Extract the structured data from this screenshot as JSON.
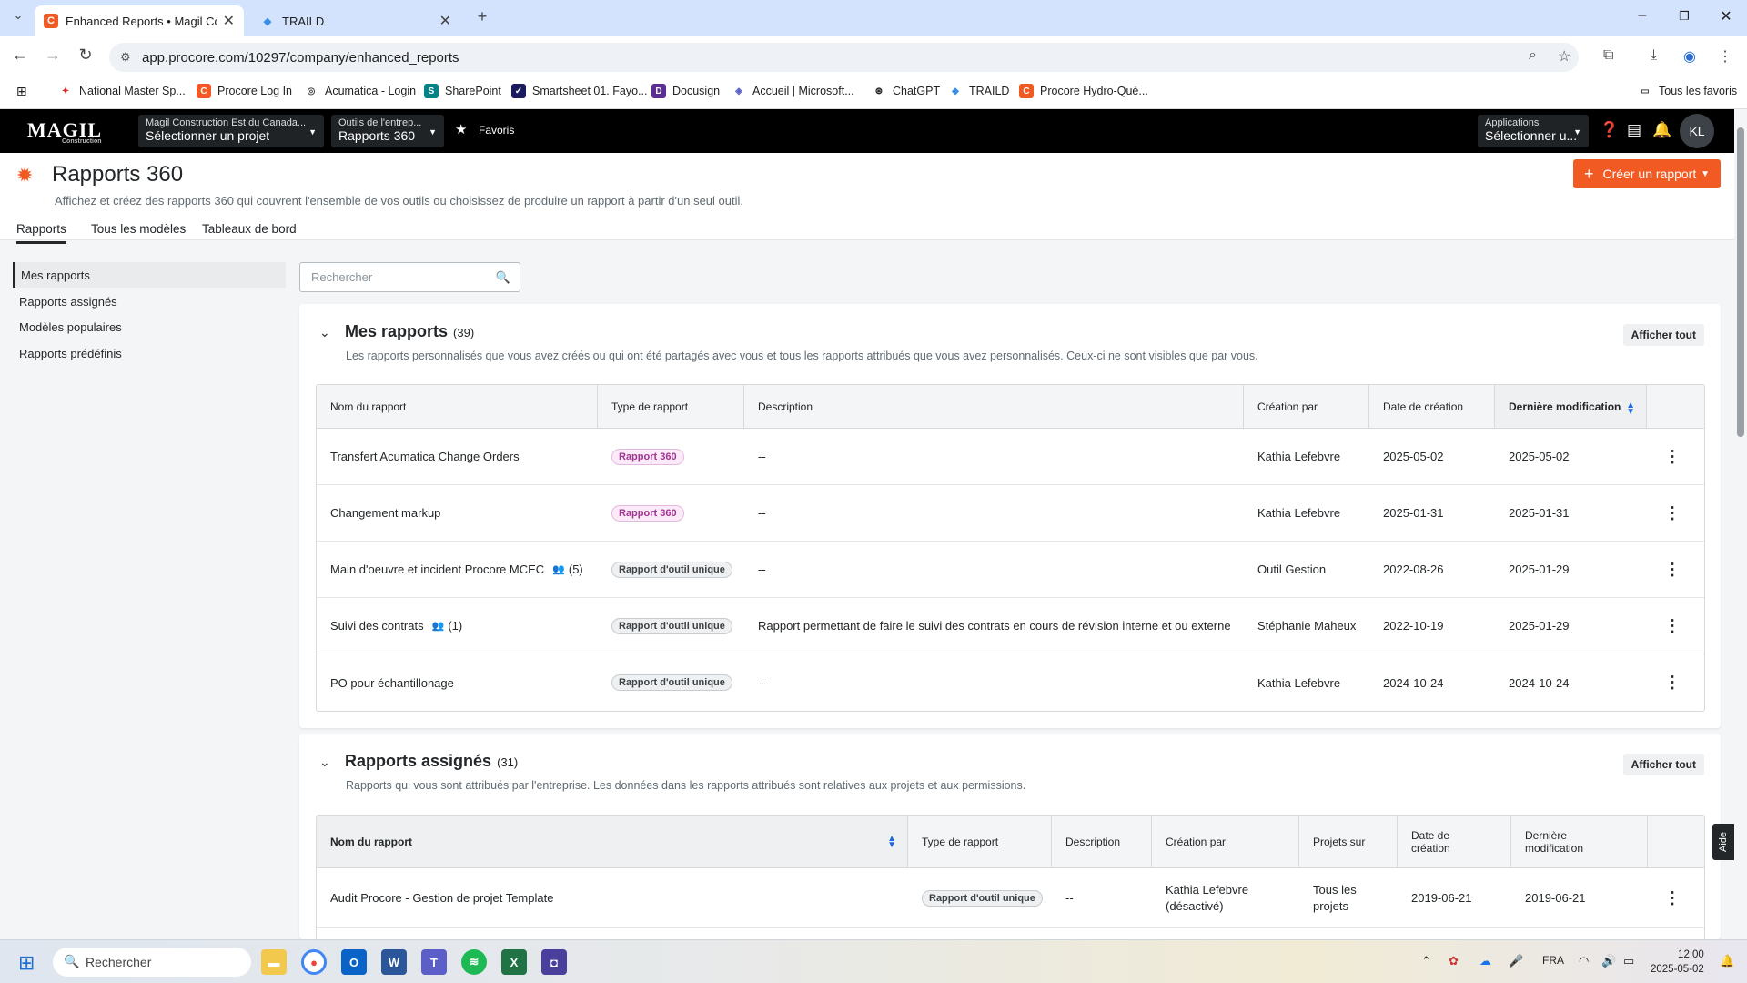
{
  "browser": {
    "tabs": [
      {
        "title": "Enhanced Reports • Magil Cons",
        "active": true
      },
      {
        "title": "TRAILD",
        "active": false
      }
    ],
    "url": "app.procore.com/10297/company/enhanced_reports",
    "bookmarks": [
      "National Master Sp...",
      "Procore Log In",
      "Acumatica - Login",
      "SharePoint",
      "Smartsheet 01. Fayo...",
      "Docusign",
      "Accueil | Microsoft...",
      "ChatGPT",
      "TRAILD",
      "Procore Hydro-Qué..."
    ],
    "all_bookmarks": "Tous les favoris"
  },
  "header": {
    "logo": "MAGIL",
    "logo_sub": "Construction",
    "company_label": "Magil Construction Est du Canada...",
    "project_value": "Sélectionner un projet",
    "tools_label": "Outils de l'entrep...",
    "tools_value": "Rapports 360",
    "favorites": "Favoris",
    "apps_label": "Applications",
    "apps_value": "Sélectionner u...",
    "avatar": "KL"
  },
  "page": {
    "title": "Rapports 360",
    "subtitle": "Affichez et créez des rapports 360 qui couvrent l'ensemble de vos outils ou choisissez de produire un rapport à partir d'un seul outil.",
    "create_button": "Créer un rapport",
    "tabs": [
      "Rapports",
      "Tous les modèles",
      "Tableaux de bord"
    ]
  },
  "sidebar": {
    "items": [
      "Mes rapports",
      "Rapports assignés",
      "Modèles populaires",
      "Rapports prédéfinis"
    ]
  },
  "search": {
    "placeholder": "Rechercher"
  },
  "my_reports": {
    "title": "Mes rapports",
    "count": "(39)",
    "description": "Les rapports personnalisés que vous avez créés ou qui ont été partagés avec vous et tous les rapports attribués que vous avez personnalisés. Ceux-ci ne sont visibles que par vous.",
    "show_all": "Afficher tout",
    "columns": [
      "Nom du rapport",
      "Type de rapport",
      "Description",
      "Création par",
      "Date de création",
      "Dernière modification"
    ],
    "rows": [
      {
        "name": "Transfert Acumatica Change Orders",
        "shared": "",
        "type": "Rapport 360",
        "description": "--",
        "created_by": "Kathia Lefebvre",
        "created": "2025-05-02",
        "modified": "2025-05-02"
      },
      {
        "name": "Changement markup",
        "shared": "",
        "type": "Rapport 360",
        "description": "--",
        "created_by": "Kathia Lefebvre",
        "created": "2025-01-31",
        "modified": "2025-01-31"
      },
      {
        "name": "Main d'oeuvre et incident Procore MCEC",
        "shared": "(5)",
        "type": "Rapport d'outil unique",
        "description": "--",
        "created_by": "Outil Gestion",
        "created": "2022-08-26",
        "modified": "2025-01-29"
      },
      {
        "name": "Suivi des contrats",
        "shared": "(1)",
        "type": "Rapport d'outil unique",
        "description": "Rapport permettant de faire le suivi des contrats en cours de révision interne et ou externe",
        "created_by": "Stéphanie Maheux",
        "created": "2022-10-19",
        "modified": "2025-01-29"
      },
      {
        "name": "PO pour échantillonage",
        "shared": "",
        "type": "Rapport d'outil unique",
        "description": "--",
        "created_by": "Kathia Lefebvre",
        "created": "2024-10-24",
        "modified": "2024-10-24"
      }
    ]
  },
  "assigned_reports": {
    "title": "Rapports assignés",
    "count": "(31)",
    "description": "Rapports qui vous sont attribués par l'entreprise. Les données dans les rapports attribués sont relatives aux projets et aux permissions.",
    "show_all": "Afficher tout",
    "columns": [
      "Nom du rapport",
      "Type de rapport",
      "Description",
      "Création par",
      "Projets sur",
      "Date de création",
      "Dernière modification"
    ],
    "rows": [
      {
        "name": "Audit Procore - Gestion de projet Template",
        "type": "Rapport d'outil unique",
        "description": "--",
        "created_by_1": "Kathia Lefebvre",
        "created_by_2": "(désactivé)",
        "projects_1": "Tous les",
        "projects_2": "projets",
        "created": "2019-06-21",
        "modified": "2019-06-21"
      }
    ]
  },
  "help_tab": "Aide",
  "taskbar": {
    "search": "Rechercher",
    "lang": "FRA",
    "time": "12:00",
    "date": "2025-05-02"
  },
  "colors": {
    "accent": "#f15a22",
    "pill_360": "#a23593",
    "sort": "#2066df"
  }
}
